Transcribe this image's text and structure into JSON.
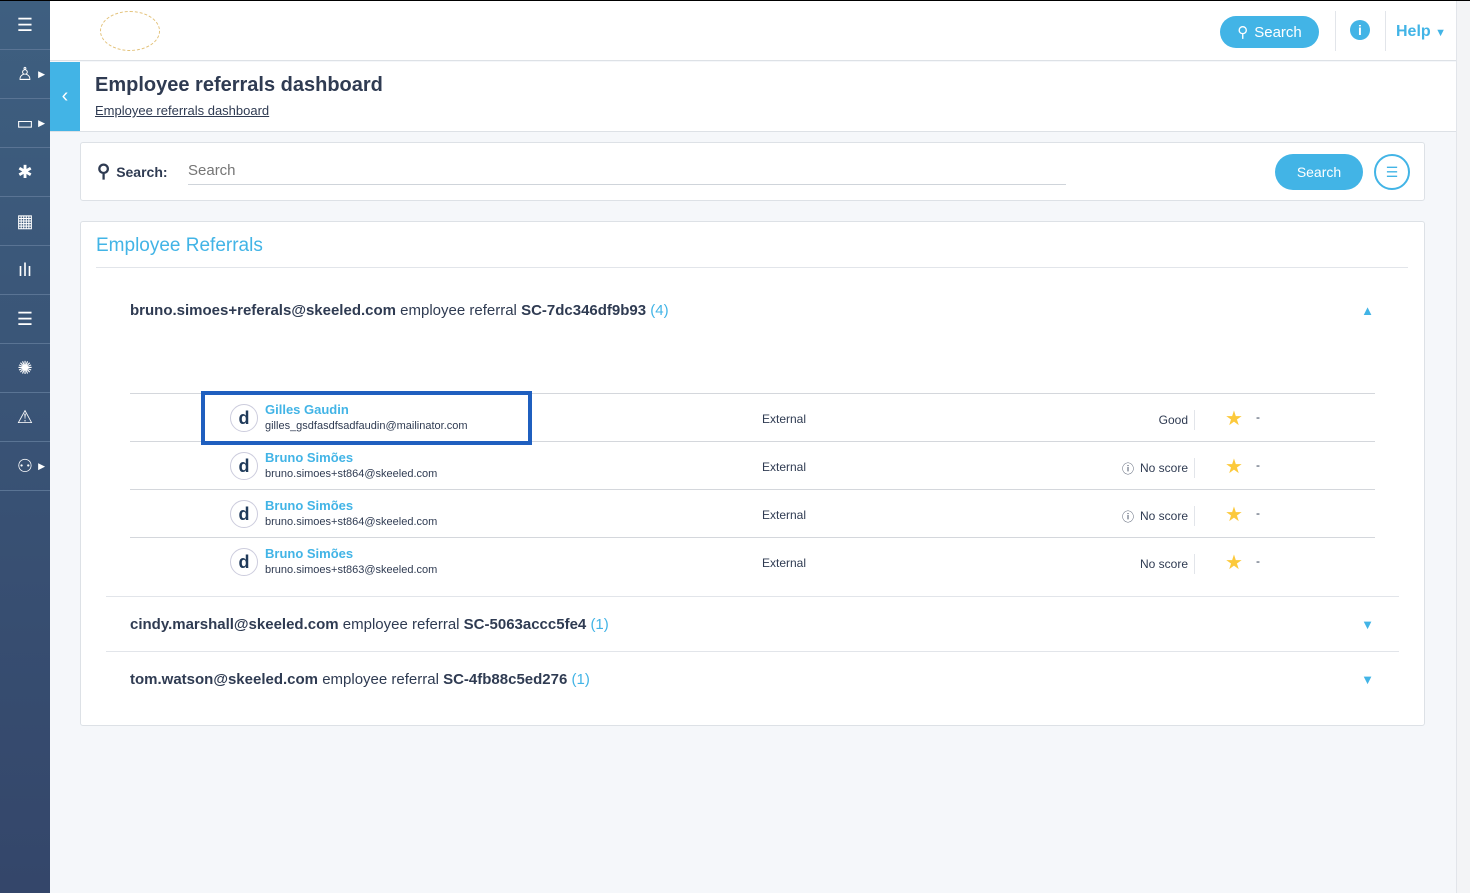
{
  "sidebar": {
    "items": [
      {
        "icon": "menu-icon",
        "glyph": "☰"
      },
      {
        "icon": "user-icon",
        "glyph": "♙"
      },
      {
        "icon": "folder-icon",
        "glyph": "▭"
      },
      {
        "icon": "asterisk-icon",
        "glyph": "✱"
      },
      {
        "icon": "calendar-icon",
        "glyph": "▦"
      },
      {
        "icon": "bar-chart-icon",
        "glyph": "ılı"
      },
      {
        "icon": "list-icon",
        "glyph": "☰"
      },
      {
        "icon": "network-icon",
        "glyph": "✺"
      },
      {
        "icon": "feedback-icon",
        "glyph": "⚠"
      },
      {
        "icon": "users-icon",
        "glyph": "⚇"
      }
    ]
  },
  "topbar": {
    "search_label": "Search",
    "help_label": "Help",
    "info_glyph": "i"
  },
  "header": {
    "title": "Employee referrals dashboard",
    "breadcrumb": "Employee referrals dashboard"
  },
  "search": {
    "label": "Search:",
    "placeholder": "Search",
    "button": "Search"
  },
  "panel": {
    "title": "Employee Referrals",
    "groups": [
      {
        "email": "bruno.simoes+referals@skeeled.com",
        "text": "employee referral",
        "code": "SC-7dc346df9b93",
        "count": "(4)",
        "expanded": true,
        "rows": [
          {
            "name": "Gilles Gaudin",
            "email": "gilles_gsdfasdfsadfaudin@mailinator.com",
            "type": "External",
            "score": "Good",
            "info": false,
            "rating": "-"
          },
          {
            "name": "Bruno Simões",
            "email": "bruno.simoes+st864@skeeled.com",
            "type": "External",
            "score": "No score",
            "info": true,
            "rating": "-"
          },
          {
            "name": "Bruno Simões",
            "email": "bruno.simoes+st864@skeeled.com",
            "type": "External",
            "score": "No score",
            "info": true,
            "rating": "-"
          },
          {
            "name": "Bruno Simões",
            "email": "bruno.simoes+st863@skeeled.com",
            "type": "External",
            "score": "No score",
            "info": false,
            "rating": "-"
          }
        ]
      },
      {
        "email": "cindy.marshall@skeeled.com",
        "text": "employee referral",
        "code": "SC-5063accc5fe4",
        "count": "(1)",
        "expanded": false
      },
      {
        "email": "tom.watson@skeeled.com",
        "text": "employee referral",
        "code": "SC-4fb88c5ed276",
        "count": "(1)",
        "expanded": false
      }
    ]
  },
  "colors": {
    "accent": "#42b4e6",
    "sidebar": "#3a5275",
    "highlight": "#1f5fbf",
    "star": "#fcc93b"
  }
}
